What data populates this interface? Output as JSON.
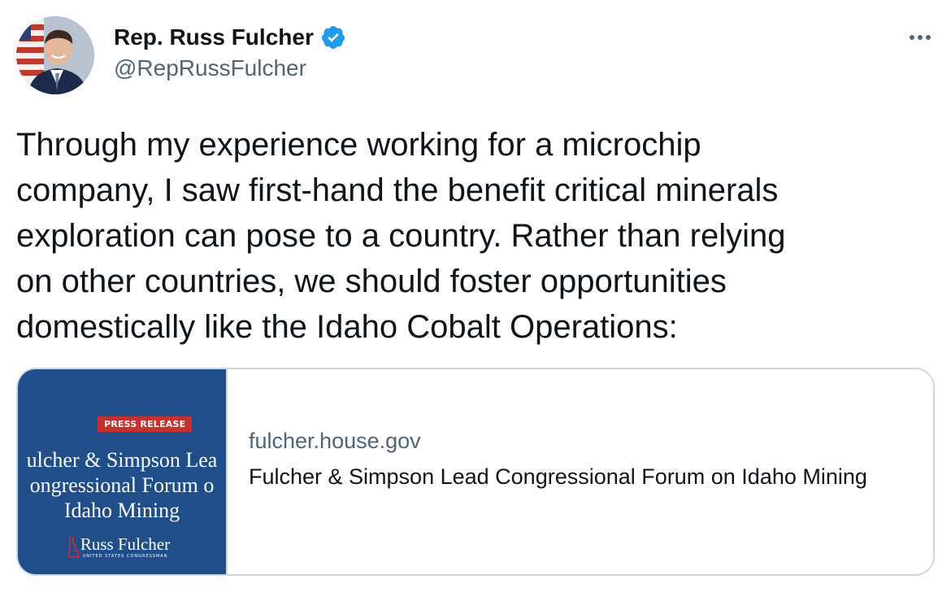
{
  "author": {
    "display_name": "Rep. Russ Fulcher",
    "handle": "@RepRussFulcher",
    "verified": true,
    "avatar_icon": "profile-photo"
  },
  "menu": {
    "icon": "more-horizontal-icon"
  },
  "tweet": {
    "text": "Through my experience working for a microchip\ncompany, I saw first-hand the benefit critical minerals\nexploration can pose to a country. Rather than relying\non other countries, we should foster opportunities\ndomestically like the Idaho Cobalt Operations:"
  },
  "link_card": {
    "domain": "fulcher.house.gov",
    "title": "Fulcher & Simpson Lead Congressional Forum on Idaho Mining",
    "thumbnail": {
      "badge": "PRESS RELEASE",
      "headline_lines": [
        "ulcher & Simpson Lea",
        "ongressional Forum o",
        "Idaho Mining"
      ],
      "logo_name": "Russ Fulcher",
      "logo_subtitle": "UNITED STATES CONGRESSMAN",
      "background_color": "#1f4e8a",
      "badge_color": "#c9302c"
    }
  },
  "colors": {
    "text_primary": "#0f1419",
    "text_secondary": "#536471",
    "verified_blue": "#1d9bf0",
    "card_border": "#cfd9de"
  }
}
